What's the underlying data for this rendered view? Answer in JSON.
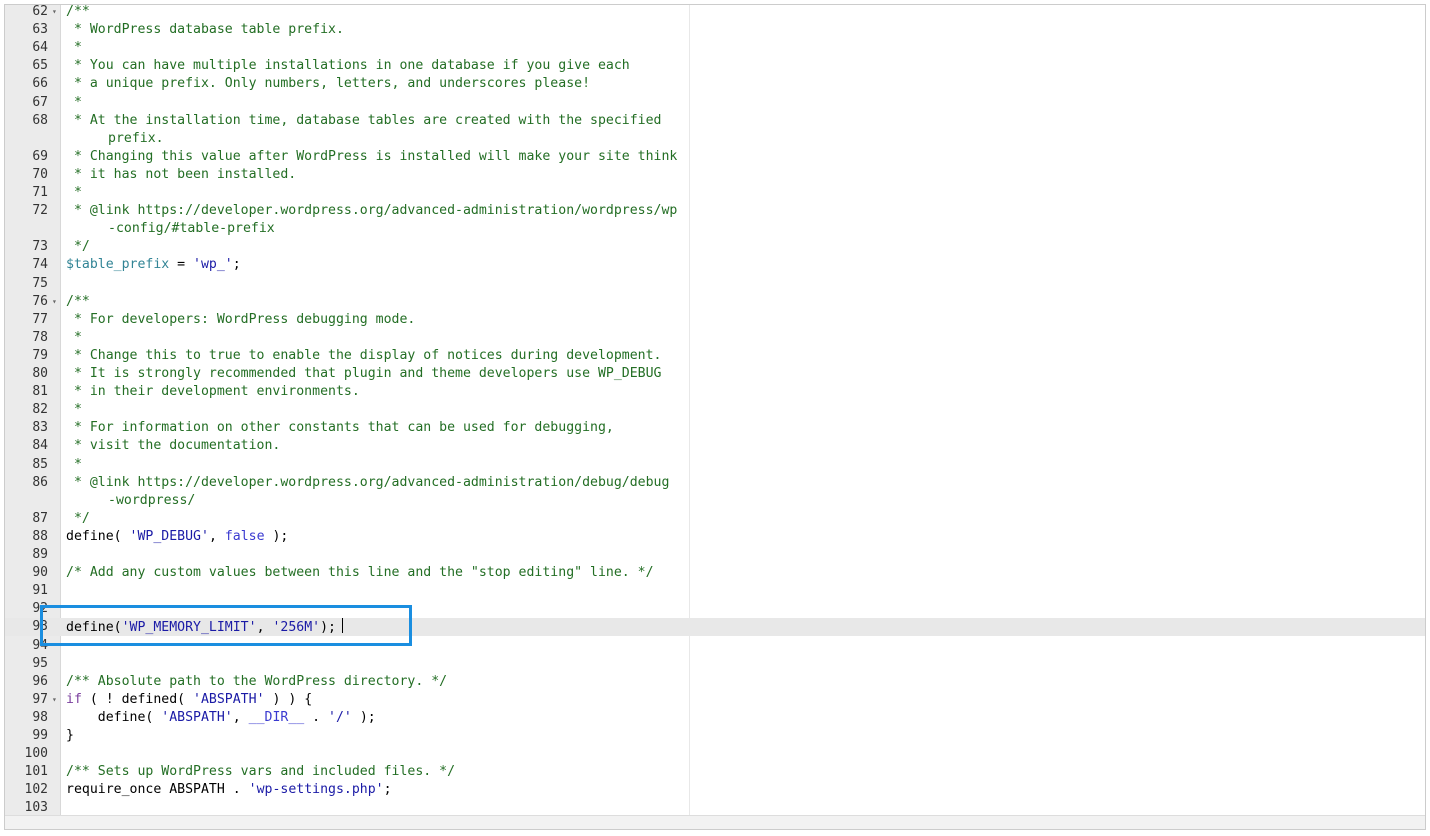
{
  "editor": {
    "lines": [
      {
        "n": "62",
        "fold": true,
        "parts": [
          [
            "comment",
            "/**"
          ]
        ]
      },
      {
        "n": "63",
        "parts": [
          [
            "comment",
            " * WordPress database table prefix."
          ]
        ]
      },
      {
        "n": "64",
        "parts": [
          [
            "comment",
            " *"
          ]
        ]
      },
      {
        "n": "65",
        "parts": [
          [
            "comment",
            " * You can have multiple installations in one database if you give each"
          ]
        ]
      },
      {
        "n": "66",
        "parts": [
          [
            "comment",
            " * a unique prefix. Only numbers, letters, and underscores please!"
          ]
        ]
      },
      {
        "n": "67",
        "parts": [
          [
            "comment",
            " *"
          ]
        ]
      },
      {
        "n": "68",
        "parts": [
          [
            "comment",
            " * At the installation time, database tables are created with the specified"
          ]
        ],
        "wrap": [
          [
            "comment",
            "prefix."
          ]
        ]
      },
      {
        "n": "69",
        "parts": [
          [
            "comment",
            " * Changing this value after WordPress is installed will make your site think"
          ]
        ]
      },
      {
        "n": "70",
        "parts": [
          [
            "comment",
            " * it has not been installed."
          ]
        ]
      },
      {
        "n": "71",
        "parts": [
          [
            "comment",
            " *"
          ]
        ]
      },
      {
        "n": "72",
        "parts": [
          [
            "comment",
            " * @link https://developer.wordpress.org/advanced-administration/wordpress/wp"
          ]
        ],
        "wrap": [
          [
            "comment",
            "-config/#table-prefix"
          ]
        ]
      },
      {
        "n": "73",
        "parts": [
          [
            "comment",
            " */"
          ]
        ]
      },
      {
        "n": "74",
        "parts": [
          [
            "var",
            "$table_prefix"
          ],
          [
            "plain",
            " = "
          ],
          [
            "str",
            "'wp_'"
          ],
          [
            "plain",
            ";"
          ]
        ]
      },
      {
        "n": "75",
        "parts": []
      },
      {
        "n": "76",
        "fold": true,
        "parts": [
          [
            "comment",
            "/**"
          ]
        ]
      },
      {
        "n": "77",
        "parts": [
          [
            "comment",
            " * For developers: WordPress debugging mode."
          ]
        ]
      },
      {
        "n": "78",
        "parts": [
          [
            "comment",
            " *"
          ]
        ]
      },
      {
        "n": "79",
        "parts": [
          [
            "comment",
            " * Change this to true to enable the display of notices during development."
          ]
        ]
      },
      {
        "n": "80",
        "parts": [
          [
            "comment",
            " * It is strongly recommended that plugin and theme developers use WP_DEBUG"
          ]
        ]
      },
      {
        "n": "81",
        "parts": [
          [
            "comment",
            " * in their development environments."
          ]
        ]
      },
      {
        "n": "82",
        "parts": [
          [
            "comment",
            " *"
          ]
        ]
      },
      {
        "n": "83",
        "parts": [
          [
            "comment",
            " * For information on other constants that can be used for debugging,"
          ]
        ]
      },
      {
        "n": "84",
        "parts": [
          [
            "comment",
            " * visit the documentation."
          ]
        ]
      },
      {
        "n": "85",
        "parts": [
          [
            "comment",
            " *"
          ]
        ]
      },
      {
        "n": "86",
        "parts": [
          [
            "comment",
            " * @link https://developer.wordpress.org/advanced-administration/debug/debug"
          ]
        ],
        "wrap": [
          [
            "comment",
            "-wordpress/"
          ]
        ]
      },
      {
        "n": "87",
        "parts": [
          [
            "comment",
            " */"
          ]
        ]
      },
      {
        "n": "88",
        "parts": [
          [
            "plain",
            "define( "
          ],
          [
            "str",
            "'WP_DEBUG'"
          ],
          [
            "plain",
            ", "
          ],
          [
            "const",
            "false"
          ],
          [
            "plain",
            " );"
          ]
        ]
      },
      {
        "n": "89",
        "parts": []
      },
      {
        "n": "90",
        "parts": [
          [
            "comment",
            "/* Add any custom values between this line and the \"stop editing\" line. */"
          ]
        ]
      },
      {
        "n": "91",
        "parts": []
      },
      {
        "n": "92",
        "parts": []
      },
      {
        "n": "93",
        "active": true,
        "cursor": true,
        "parts": [
          [
            "plain",
            "define("
          ],
          [
            "str",
            "'WP_MEMORY_LIMIT'"
          ],
          [
            "plain",
            ", "
          ],
          [
            "str",
            "'256M'"
          ],
          [
            "plain",
            ");"
          ]
        ]
      },
      {
        "n": "94",
        "parts": []
      },
      {
        "n": "95",
        "parts": []
      },
      {
        "n": "96",
        "parts": [
          [
            "comment",
            "/** Absolute path to the WordPress directory. */"
          ]
        ]
      },
      {
        "n": "97",
        "fold": true,
        "parts": [
          [
            "kw",
            "if"
          ],
          [
            "plain",
            " ( ! defined( "
          ],
          [
            "str",
            "'ABSPATH'"
          ],
          [
            "plain",
            " ) ) {"
          ]
        ]
      },
      {
        "n": "98",
        "parts": [
          [
            "plain",
            "    define( "
          ],
          [
            "str",
            "'ABSPATH'"
          ],
          [
            "plain",
            ", "
          ],
          [
            "const",
            "__DIR__"
          ],
          [
            "plain",
            " . "
          ],
          [
            "str",
            "'/'"
          ],
          [
            "plain",
            " );"
          ]
        ]
      },
      {
        "n": "99",
        "parts": [
          [
            "plain",
            "}"
          ]
        ]
      },
      {
        "n": "100",
        "parts": []
      },
      {
        "n": "101",
        "parts": [
          [
            "comment",
            "/** Sets up WordPress vars and included files. */"
          ]
        ]
      },
      {
        "n": "102",
        "parts": [
          [
            "plain",
            "require_once ABSPATH . "
          ],
          [
            "str",
            "'wp-settings.php'"
          ],
          [
            "plain",
            ";"
          ]
        ]
      },
      {
        "n": "103",
        "parts": []
      }
    ],
    "fold_icon": "fold-arrow-icon",
    "highlight_color": "#1a8ee0"
  }
}
